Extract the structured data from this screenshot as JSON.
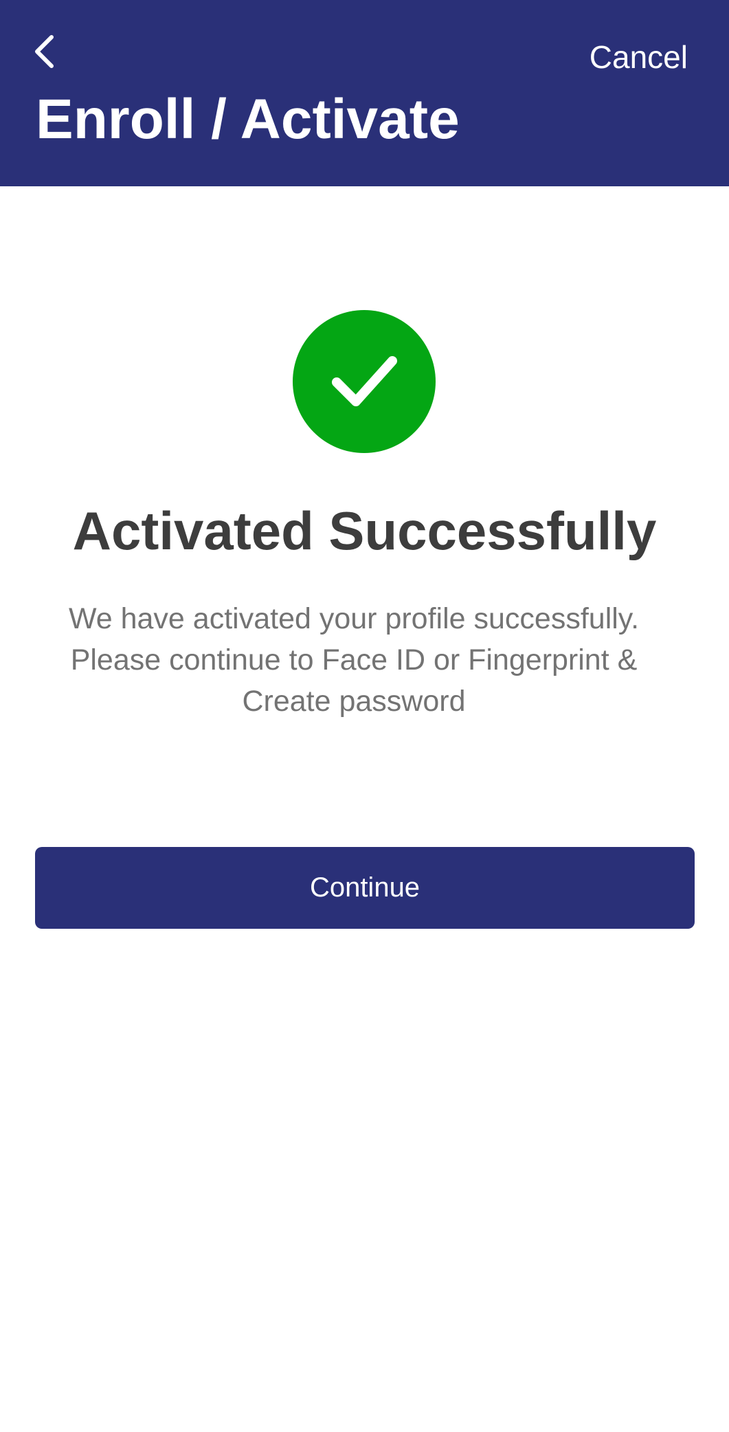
{
  "header": {
    "back_icon": "chevron-left-icon",
    "cancel_label": "Cancel",
    "title": "Enroll / Activate"
  },
  "success": {
    "icon": "checkmark-circle-icon",
    "icon_color": "#04a614",
    "title": "Activated Successfully",
    "message_lines": [
      "We have activated your profile successfully.",
      "Please continue to Face ID  or Fingerprint &",
      "Create password"
    ]
  },
  "actions": {
    "continue_label": "Continue"
  },
  "colors": {
    "brand": "#2a3078",
    "background": "#ffffff",
    "title_text": "#3d3d3d",
    "body_text": "#737373"
  }
}
